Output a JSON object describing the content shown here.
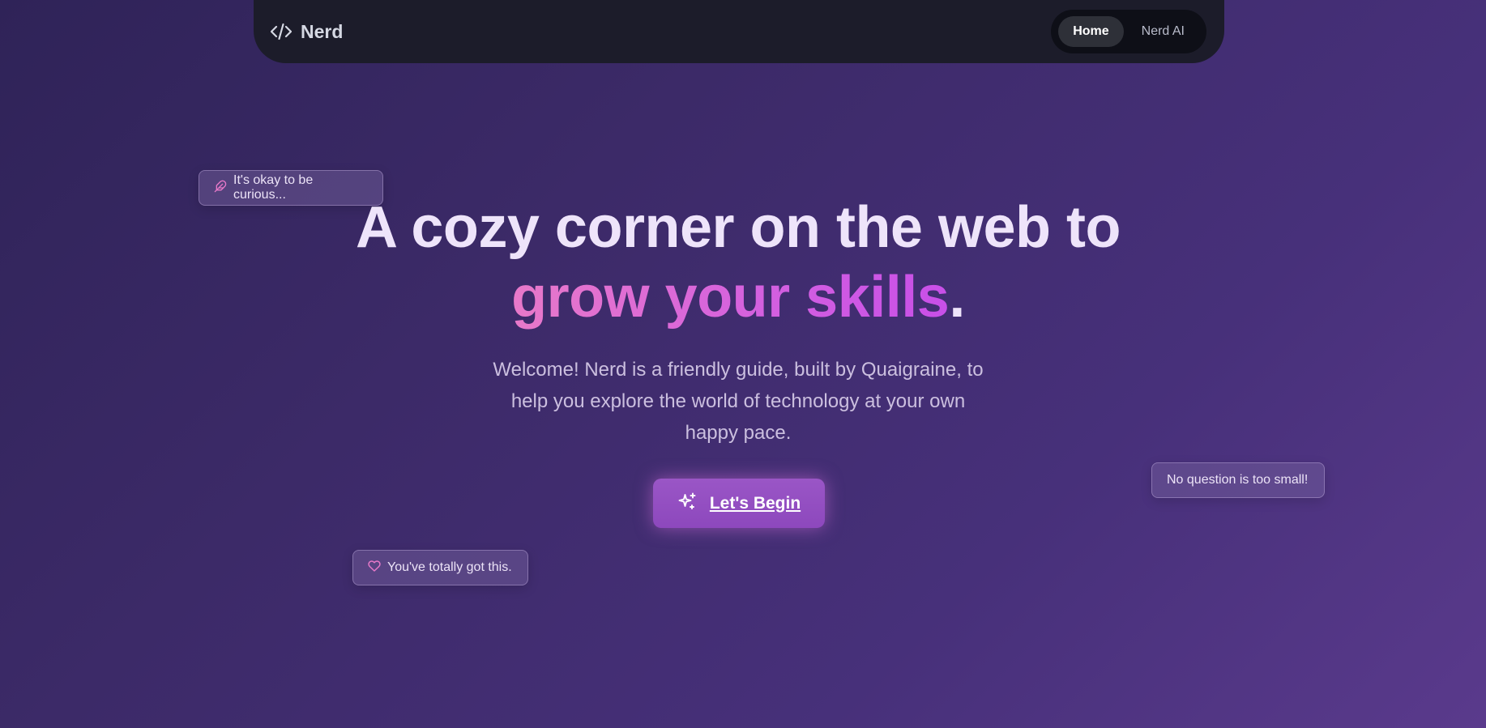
{
  "nav": {
    "brand": "Nerd",
    "brand_icon": "code-icon",
    "items": [
      {
        "label": "Home",
        "active": true
      },
      {
        "label": "Nerd AI",
        "active": false
      }
    ]
  },
  "chips": {
    "curious": {
      "text": "It's okay to be curious...",
      "icon": "feather-icon"
    },
    "question": {
      "text": "No question is too small!"
    },
    "gotthis": {
      "text": "You've totally got this.",
      "icon": "heart-icon"
    }
  },
  "hero": {
    "title_line1": "A cozy corner on the web to",
    "title_highlight": "grow your skills",
    "title_end": ".",
    "subtitle": "Welcome! Nerd is a friendly guide, built by Quaigraine, to help you explore the world of technology at your own happy pace.",
    "cta_label": "Let's Begin",
    "cta_icon": "sparkles-icon"
  },
  "colors": {
    "accent_pink": "#e879c9",
    "accent_purple": "#c84fe8",
    "navbar_bg": "#1c1c2a",
    "cta_bg": "#9a56c6"
  }
}
